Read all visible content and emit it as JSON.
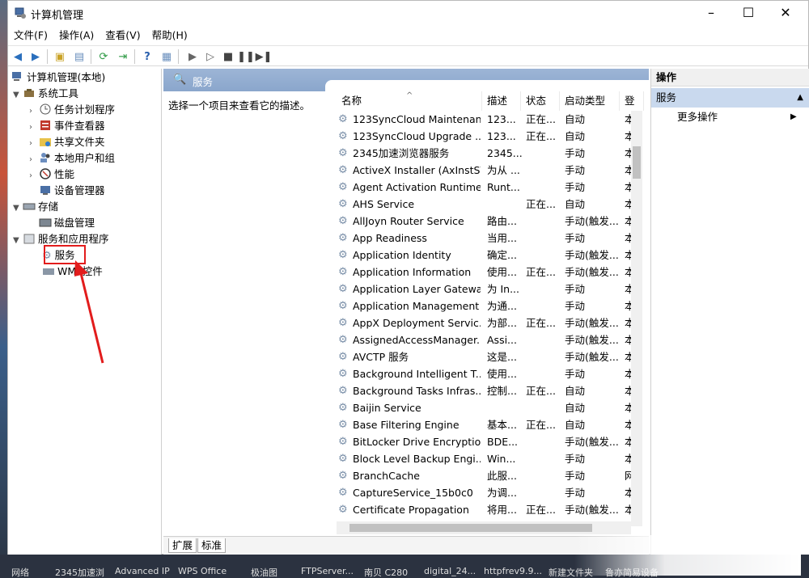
{
  "window": {
    "title": "计算机管理"
  },
  "menu": [
    "文件(F)",
    "操作(A)",
    "查看(V)",
    "帮助(H)"
  ],
  "tree": {
    "root": "计算机管理(本地)",
    "system_tools": "系统工具",
    "task_scheduler": "任务计划程序",
    "event_viewer": "事件查看器",
    "shared_folders": "共享文件夹",
    "local_users": "本地用户和组",
    "performance": "性能",
    "device_manager": "设备管理器",
    "storage": "存储",
    "disk_management": "磁盘管理",
    "services_apps": "服务和应用程序",
    "services": "服务",
    "wmi": "WMI 控件"
  },
  "center": {
    "header": "服务",
    "description": "选择一个项目来查看它的描述。",
    "columns": [
      "名称",
      "描述",
      "状态",
      "启动类型",
      "登"
    ],
    "rows": [
      [
        "123SyncCloud Maintenan...",
        "123...",
        "正在...",
        "自动",
        "本"
      ],
      [
        "123SyncCloud Upgrade ...",
        "123...",
        "正在...",
        "自动",
        "本"
      ],
      [
        "2345加速浏览器服务",
        "2345...",
        "",
        "手动",
        "本"
      ],
      [
        "ActiveX Installer (AxInstSV)",
        "为从 ...",
        "",
        "手动",
        "本"
      ],
      [
        "Agent Activation Runtime...",
        "Runt...",
        "",
        "手动",
        "本"
      ],
      [
        "AHS Service",
        "",
        "正在...",
        "自动",
        "本"
      ],
      [
        "AllJoyn Router Service",
        "路由...",
        "",
        "手动(触发...",
        "本"
      ],
      [
        "App Readiness",
        "当用...",
        "",
        "手动",
        "本"
      ],
      [
        "Application Identity",
        "确定...",
        "",
        "手动(触发...",
        "本"
      ],
      [
        "Application Information",
        "使用...",
        "正在...",
        "手动(触发...",
        "本"
      ],
      [
        "Application Layer Gatewa...",
        "为 In...",
        "",
        "手动",
        "本"
      ],
      [
        "Application Management",
        "为通...",
        "",
        "手动",
        "本"
      ],
      [
        "AppX Deployment Servic...",
        "为部...",
        "正在...",
        "手动(触发...",
        "本"
      ],
      [
        "AssignedAccessManager...",
        "Assi...",
        "",
        "手动(触发...",
        "本"
      ],
      [
        "AVCTP 服务",
        "这是...",
        "",
        "手动(触发...",
        "本"
      ],
      [
        "Background Intelligent T...",
        "使用...",
        "",
        "手动",
        "本"
      ],
      [
        "Background Tasks Infras...",
        "控制...",
        "正在...",
        "自动",
        "本"
      ],
      [
        "Baijin Service",
        "",
        "",
        "自动",
        "本"
      ],
      [
        "Base Filtering Engine",
        "基本...",
        "正在...",
        "自动",
        "本"
      ],
      [
        "BitLocker Drive Encryptio...",
        "BDE...",
        "",
        "手动(触发...",
        "本"
      ],
      [
        "Block Level Backup Engi...",
        "Win...",
        "",
        "手动",
        "本"
      ],
      [
        "BranchCache",
        "此服...",
        "",
        "手动",
        "网"
      ],
      [
        "CaptureService_15b0c0",
        "为调...",
        "",
        "手动",
        "本"
      ],
      [
        "Certificate Propagation",
        "将用...",
        "正在...",
        "手动(触发...",
        "本"
      ]
    ],
    "tabs": [
      "扩展",
      "标准"
    ]
  },
  "actions": {
    "header": "操作",
    "section": "服务",
    "more": "更多操作"
  },
  "taskbar": [
    "网络",
    "2345加速浏",
    "Advanced IP",
    "WPS Office",
    "极油图",
    "FTPServer...",
    "南贝 C280",
    "digital_24...",
    "httpfrev9.9...",
    "新建文件夹",
    "鲁亦简易设备"
  ],
  "colors": {
    "accent": "#8aa6cc",
    "highlight": "#e21c1c",
    "selection": "#c9d9ee"
  }
}
